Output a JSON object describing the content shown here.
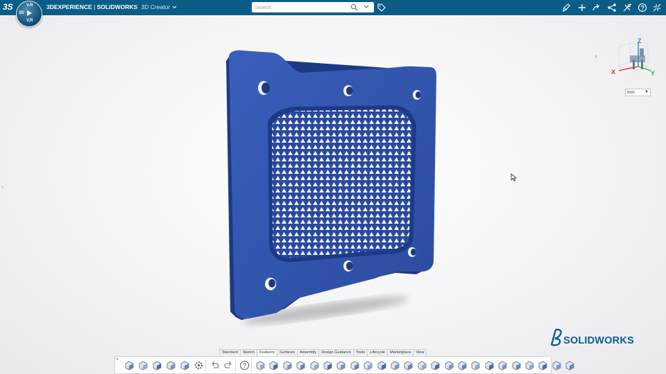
{
  "app": {
    "brand_prefix": "3DEXPERIENCE",
    "separator": " | ",
    "brand_product": "SOLIDWORKS",
    "role": "3D Creator",
    "role_chevron_icon": "chevron-down-icon"
  },
  "compass": {
    "north": "V.R",
    "west": "3D",
    "east": "",
    "south": "V,R"
  },
  "search": {
    "placeholder": "Search",
    "value": ""
  },
  "top_actions": [
    "tag-icon",
    "share-icon",
    "add-icon",
    "forward-icon",
    "network-share-icon",
    "tools-icon",
    "help-icon",
    "collapse-icon"
  ],
  "viewport": {
    "units": "mm",
    "triad": {
      "x": "X",
      "y": "Y",
      "z": "Z"
    }
  },
  "colors": {
    "topbar": "#0b5d87",
    "model_blue": "#2c4fa5",
    "model_dark": "#1c3a82",
    "brand_blue": "#0c5b8f",
    "triad_x": "#d22a2a",
    "triad_y": "#35a93a",
    "triad_z": "#2b7fd4"
  },
  "brand_watermark": "SOLIDWORKS",
  "action_bar": {
    "tabs": [
      "Standard",
      "Sketch",
      "Features",
      "Surfaces",
      "Assembly",
      "Design Guidance",
      "Tools",
      "Lifecycle",
      "Marketplace",
      "View"
    ],
    "active_tab": "Features",
    "tools": [
      "new-3d-shape-icon",
      "open-icon",
      "save-icon",
      "refresh-icon",
      "tree-icon",
      "settings-icon",
      "undo-icon",
      "redo-icon",
      "help-icon",
      "extrude-icon",
      "revolve-icon",
      "sweep-icon",
      "loft-icon",
      "hole-icon",
      "fillet-icon",
      "chamfer-icon",
      "shell-icon",
      "draft-icon",
      "rib-icon",
      "mirror-icon",
      "pattern-icon",
      "split-icon",
      "combine-icon",
      "thicken-icon",
      "boundary-icon",
      "wrap-icon",
      "intersect-icon",
      "move-face-icon",
      "delete-face-icon",
      "lattice-icon",
      "measure-icon",
      "emboss-icon",
      "dome-icon"
    ]
  }
}
